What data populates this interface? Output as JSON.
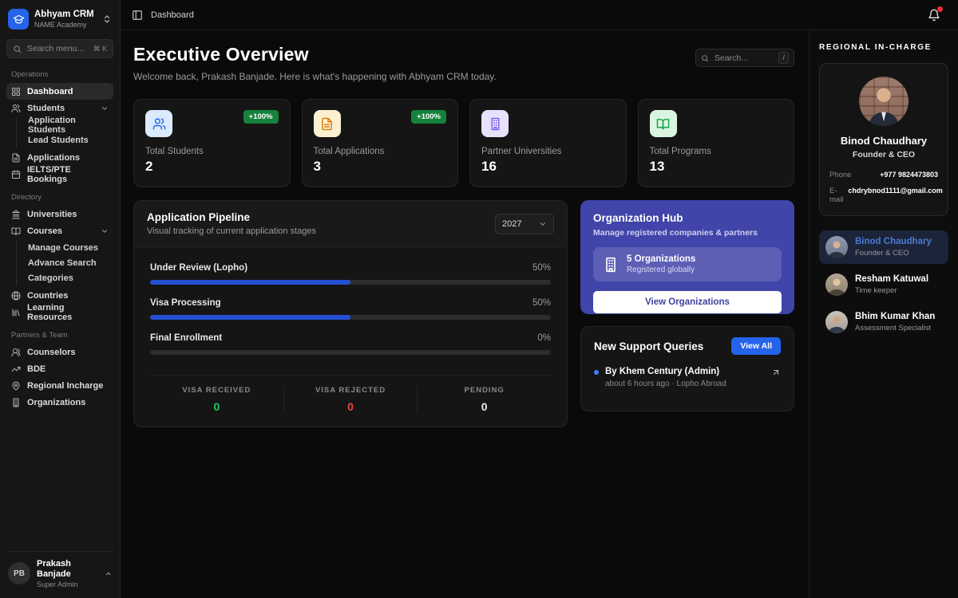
{
  "app": {
    "name": "Abhyam CRM",
    "subtitle": "NAME Academy"
  },
  "topbar": {
    "breadcrumb": "Dashboard"
  },
  "sidebar": {
    "search": {
      "placeholder": "Search menu...",
      "shortcut": "⌘ K"
    },
    "sections": [
      {
        "label": "Operations",
        "items": [
          {
            "label": "Dashboard",
            "icon": "dashboard-grid-icon",
            "active": true
          },
          {
            "label": "Students",
            "icon": "users-icon",
            "children": [
              "Application Students",
              "Lead Students"
            ]
          },
          {
            "label": "Applications",
            "icon": "file-text-icon"
          },
          {
            "label": "IELTS/PTE Bookings",
            "icon": "calendar-icon"
          }
        ]
      },
      {
        "label": "Directory",
        "items": [
          {
            "label": "Universities",
            "icon": "university-icon"
          },
          {
            "label": "Courses",
            "icon": "book-open-icon",
            "children": [
              "Manage Courses",
              "Advance Search",
              "Categories"
            ]
          },
          {
            "label": "Countries",
            "icon": "globe-icon"
          },
          {
            "label": "Learning Resources",
            "icon": "library-icon"
          }
        ]
      },
      {
        "label": "Partners & Team",
        "items": [
          {
            "label": "Counselors",
            "icon": "users-round-icon"
          },
          {
            "label": "BDE",
            "icon": "trending-up-icon"
          },
          {
            "label": "Regional Incharge",
            "icon": "map-pin-icon"
          },
          {
            "label": "Organizations",
            "icon": "building-icon"
          }
        ]
      }
    ],
    "user": {
      "initials": "PB",
      "name": "Prakash Banjade",
      "role": "Super Admin"
    }
  },
  "header": {
    "title": "Executive Overview",
    "subtitle": "Welcome back, Prakash Banjade. Here is what's happening with Abhyam CRM today.",
    "search": {
      "placeholder": "Search...",
      "shortcut": "/"
    }
  },
  "stats": [
    {
      "label": "Total Students",
      "value": "2",
      "badge": "+100%",
      "icon": "students-users-icon",
      "icon_bg": "#dbeafe",
      "icon_color": "#2563eb"
    },
    {
      "label": "Total Applications",
      "value": "3",
      "badge": "+100%",
      "icon": "application-file-icon",
      "icon_bg": "#fcf0d0",
      "icon_color": "#d97706"
    },
    {
      "label": "Partner Universities",
      "value": "16",
      "badge": "",
      "icon": "university-building-icon",
      "icon_bg": "#e7e1fb",
      "icon_color": "#7c5cf0"
    },
    {
      "label": "Total Programs",
      "value": "13",
      "badge": "",
      "icon": "programs-book-icon",
      "icon_bg": "#d9f5e2",
      "icon_color": "#16a34a"
    }
  ],
  "pipeline": {
    "title": "Application Pipeline",
    "subtitle": "Visual tracking of current application stages",
    "year": "2027",
    "stages": [
      {
        "label": "Under Review (Lopho)",
        "percent": "50%",
        "value": 50
      },
      {
        "label": "Visa Processing",
        "percent": "50%",
        "value": 50
      },
      {
        "label": "Final Enrollment",
        "percent": "0%",
        "value": 0
      }
    ],
    "summary": [
      {
        "label": "VISA RECEIVED",
        "value": "0",
        "color": "#22c55e"
      },
      {
        "label": "VISA REJECTED",
        "value": "0",
        "color": "#ef4444"
      },
      {
        "label": "PENDING",
        "value": "0",
        "color": "#e8e8e8"
      }
    ]
  },
  "org_hub": {
    "title": "Organization Hub",
    "subtitle": "Manage registered companies & partners",
    "stat_title": "5 Organizations",
    "stat_sub": "Registered globally",
    "button_label": "View Organizations",
    "accent": "#4144a8"
  },
  "support": {
    "title": "New Support Queries",
    "view_all_label": "View All",
    "items": [
      {
        "title": "By Khem Century (Admin)",
        "meta": "about 6 hours ago · Lopho Abroad"
      }
    ]
  },
  "regional": {
    "heading": "REGIONAL IN-CHARGE",
    "profile": {
      "name": "Binod Chaudhary",
      "role": "Founder & CEO",
      "phone_label": "Phone",
      "phone": "+977 9824473803",
      "email_label": "E-mail",
      "email": "chdrybnod1111@gmail.com"
    },
    "people": [
      {
        "name": "Binod Chaudhary",
        "role": "Founder & CEO",
        "active": true
      },
      {
        "name": "Resham Katuwal",
        "role": "Time keeper",
        "active": false
      },
      {
        "name": "Bhim Kumar Khan",
        "role": "Assessment Specialist",
        "active": false
      }
    ]
  },
  "colors": {
    "accent_blue": "#2563eb",
    "bar_blue": "#2450d4",
    "badge_green": "#15823b",
    "hub_purple": "#4144a8"
  }
}
